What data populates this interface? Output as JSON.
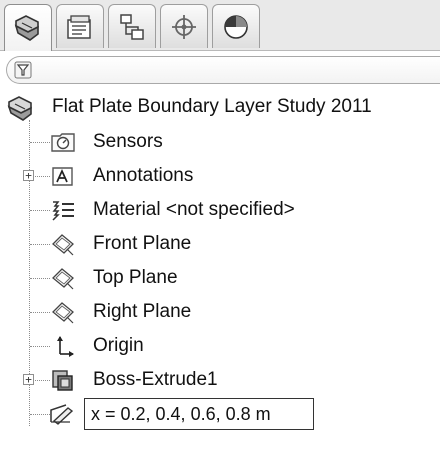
{
  "tabs": [
    {
      "icon": "feature-manager-icon",
      "active": true
    },
    {
      "icon": "property-manager-icon",
      "active": false
    },
    {
      "icon": "configuration-manager-icon",
      "active": false
    },
    {
      "icon": "dimxpert-manager-icon",
      "active": false
    },
    {
      "icon": "display-manager-icon",
      "active": false
    }
  ],
  "filter": {
    "icon": "filter-icon",
    "value": ""
  },
  "tree": {
    "root": {
      "label": "Flat Plate Boundary Layer Study 2011",
      "icon": "part-icon"
    },
    "items": [
      {
        "label": "Sensors",
        "icon": "sensors-folder-icon",
        "expandable": false
      },
      {
        "label": "Annotations",
        "icon": "annotations-icon",
        "expandable": true,
        "expander": "+"
      },
      {
        "label": "Material <not specified>",
        "icon": "material-icon",
        "expandable": false
      },
      {
        "label": "Front Plane",
        "icon": "plane-icon",
        "expandable": false
      },
      {
        "label": "Top Plane",
        "icon": "plane-icon",
        "expandable": false
      },
      {
        "label": "Right Plane",
        "icon": "plane-icon",
        "expandable": false
      },
      {
        "label": "Origin",
        "icon": "origin-icon",
        "expandable": false
      },
      {
        "label": "Boss-Extrude1",
        "icon": "boss-extrude-icon",
        "expandable": true,
        "expander": "+"
      },
      {
        "label": "x = 0.2, 0.4, 0.6, 0.8 m",
        "icon": "sketch-icon",
        "expandable": false,
        "editing": true
      }
    ]
  }
}
